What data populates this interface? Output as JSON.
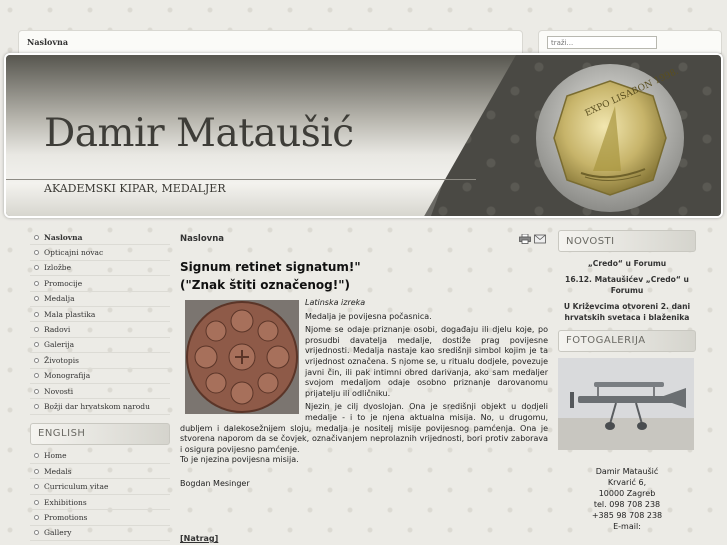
{
  "topbar": {
    "breadcrumb": "Naslovna"
  },
  "search": {
    "placeholder": "traži..."
  },
  "banner": {
    "title": "Damir Mataušić",
    "subtitle": "AKADEMSKI KIPAR, MEDALJER",
    "coin_text": "EXPO LISABON 1998."
  },
  "sidebar": {
    "items": [
      {
        "label": "Naslovna"
      },
      {
        "label": "Opticajni novac"
      },
      {
        "label": "Izložbe"
      },
      {
        "label": "Promocije"
      },
      {
        "label": "Medalja"
      },
      {
        "label": "Mala plastika"
      },
      {
        "label": "Radovi"
      },
      {
        "label": "Galerija"
      },
      {
        "label": "Životopis"
      },
      {
        "label": "Monografija"
      },
      {
        "label": "Novosti"
      },
      {
        "label": "Božji dar hrvatskom narodu"
      }
    ],
    "english_header": "ENGLISH",
    "english_items": [
      {
        "label": "Home"
      },
      {
        "label": "Medals"
      },
      {
        "label": "Curriculum vitae"
      },
      {
        "label": "Exhibitions"
      },
      {
        "label": "Promotions"
      },
      {
        "label": "Gallery"
      }
    ]
  },
  "main": {
    "breadcrumb": "Naslovna",
    "heading_line1": "Signum retinet signatum!\"",
    "heading_line2": "(\"Znak štiti označenog!\")",
    "quote_source": "Latinska izreka",
    "p1": "Medalja je povijesna počasnica.",
    "p2": "Njome se odaje priznanje osobi, događaju ili djelu koje, po prosudbi davatelja medalje, dostiže prag povijesne vrijednosti. Medalja nastaje kao središnji simbol kojim je ta vrijednost označena. S njome se, u ritualu dodjele, povezuje javni čin, ili pak intimni obred darivanja, ako sam medaljer svojom medaljom odaje osobno priznanje darovanomu prijatelju ili odličniku.",
    "p3": "Njezin je cilj dvoslojan. Ona je središnji objekt u dodjeli medalje - i to je njena aktualna misija. No, u drugomu, dubljem i dalekosežnijem sloju, medalja je nositelj misije povijesnog pamćenja. Ona je stvorena naporom da se čovjek, označivanjem neprolaznih vrijednosti, bori protiv zaborava i osigura povijesno pamćenje.",
    "p4": "To je njezina povijesna misija.",
    "author": "Bogdan Mesinger",
    "back_link": "[Natrag]"
  },
  "news": {
    "header": "NOVOSTI",
    "items": [
      {
        "label": "„Credo“ u Forumu"
      },
      {
        "label": "16.12. Mataušićev „Credo“ u Forumu"
      },
      {
        "label": "U Križevcima otvoreni 2. dani hrvatskih svetaca i blaženika"
      }
    ]
  },
  "gallery": {
    "header": "FOTOGALERIJA"
  },
  "contact": {
    "lines": [
      "Damir Mataušić",
      "Krvarić 6,",
      "10000 Zagreb",
      "tel. 098 708 238",
      "+385 98 708 238",
      "E-mail:"
    ]
  }
}
